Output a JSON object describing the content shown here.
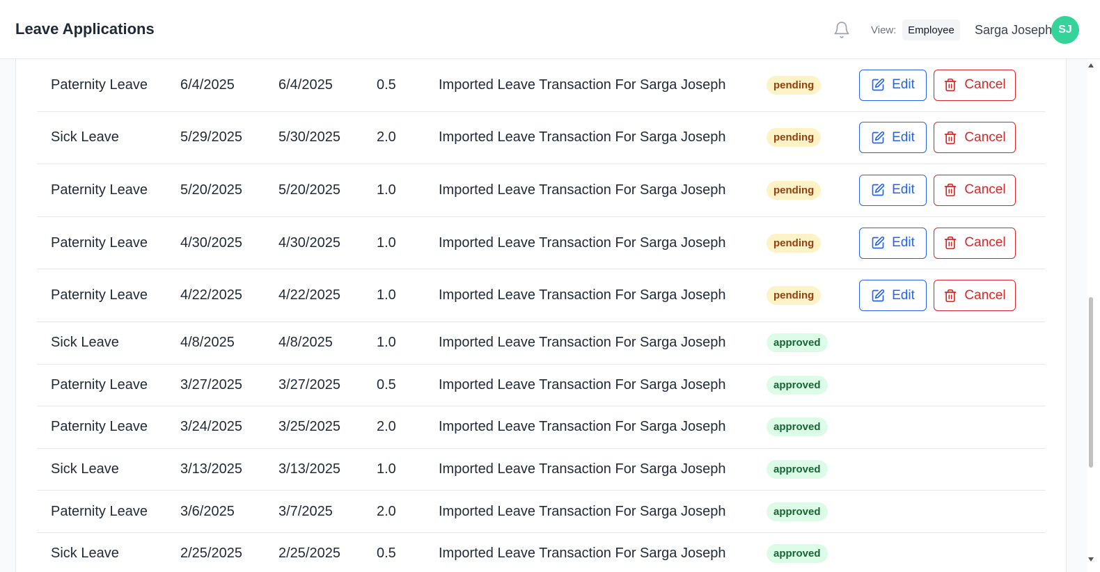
{
  "header": {
    "title": "Leave Applications",
    "view_label": "View:",
    "view_value": "Employee",
    "user_name": "Sarga Joseph",
    "user_initials": "SJ"
  },
  "actions": {
    "edit_label": "Edit",
    "cancel_label": "Cancel"
  },
  "colors": {
    "accent_blue": "#2563eb",
    "danger_red": "#dc2626",
    "pending_bg": "#fef3c7",
    "approved_bg": "#dcfce7",
    "avatar_bg": "#34d399"
  },
  "rows": [
    {
      "type": "Paternity Leave",
      "start": "6/4/2025",
      "end": "6/4/2025",
      "days": "0.5",
      "reason": "Imported Leave Transaction For Sarga Joseph",
      "status": "pending"
    },
    {
      "type": "Sick Leave",
      "start": "5/29/2025",
      "end": "5/30/2025",
      "days": "2.0",
      "reason": "Imported Leave Transaction For Sarga Joseph",
      "status": "pending"
    },
    {
      "type": "Paternity Leave",
      "start": "5/20/2025",
      "end": "5/20/2025",
      "days": "1.0",
      "reason": "Imported Leave Transaction For Sarga Joseph",
      "status": "pending"
    },
    {
      "type": "Paternity Leave",
      "start": "4/30/2025",
      "end": "4/30/2025",
      "days": "1.0",
      "reason": "Imported Leave Transaction For Sarga Joseph",
      "status": "pending"
    },
    {
      "type": "Paternity Leave",
      "start": "4/22/2025",
      "end": "4/22/2025",
      "days": "1.0",
      "reason": "Imported Leave Transaction For Sarga Joseph",
      "status": "pending"
    },
    {
      "type": "Sick Leave",
      "start": "4/8/2025",
      "end": "4/8/2025",
      "days": "1.0",
      "reason": "Imported Leave Transaction For Sarga Joseph",
      "status": "approved"
    },
    {
      "type": "Paternity Leave",
      "start": "3/27/2025",
      "end": "3/27/2025",
      "days": "0.5",
      "reason": "Imported Leave Transaction For Sarga Joseph",
      "status": "approved"
    },
    {
      "type": "Paternity Leave",
      "start": "3/24/2025",
      "end": "3/25/2025",
      "days": "2.0",
      "reason": "Imported Leave Transaction For Sarga Joseph",
      "status": "approved"
    },
    {
      "type": "Sick Leave",
      "start": "3/13/2025",
      "end": "3/13/2025",
      "days": "1.0",
      "reason": "Imported Leave Transaction For Sarga Joseph",
      "status": "approved"
    },
    {
      "type": "Paternity Leave",
      "start": "3/6/2025",
      "end": "3/7/2025",
      "days": "2.0",
      "reason": "Imported Leave Transaction For Sarga Joseph",
      "status": "approved"
    },
    {
      "type": "Sick Leave",
      "start": "2/25/2025",
      "end": "2/25/2025",
      "days": "0.5",
      "reason": "Imported Leave Transaction For Sarga Joseph",
      "status": "approved"
    }
  ]
}
